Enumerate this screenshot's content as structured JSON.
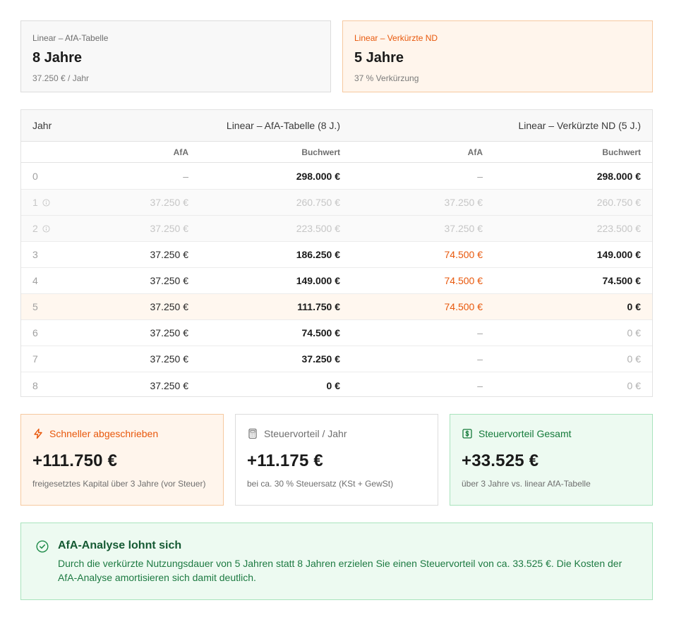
{
  "cards": {
    "linear": {
      "label": "Linear – AfA-Tabelle",
      "value": "8 Jahre",
      "sub": "37.250 € / Jahr"
    },
    "verkuerzt": {
      "label": "Linear – Verkürzte ND",
      "value": "5 Jahre",
      "sub": "37 % Verkürzung"
    }
  },
  "table": {
    "col_year": "Jahr",
    "group1": "Linear – AfA-Tabelle (8 J.)",
    "group2": "Linear – Verkürzte ND (5 J.)",
    "afa": "AfA",
    "buchwert": "Buchwert",
    "rows": [
      {
        "year": "0",
        "afa1": "–",
        "bw1": "298.000 €",
        "afa2": "–",
        "bw2": "298.000 €"
      },
      {
        "year": "1",
        "afa1": "37.250 €",
        "bw1": "260.750 €",
        "afa2": "37.250 €",
        "bw2": "260.750 €"
      },
      {
        "year": "2",
        "afa1": "37.250 €",
        "bw1": "223.500 €",
        "afa2": "37.250 €",
        "bw2": "223.500 €"
      },
      {
        "year": "3",
        "afa1": "37.250 €",
        "bw1": "186.250 €",
        "afa2": "74.500 €",
        "bw2": "149.000 €"
      },
      {
        "year": "4",
        "afa1": "37.250 €",
        "bw1": "149.000 €",
        "afa2": "74.500 €",
        "bw2": "74.500 €"
      },
      {
        "year": "5",
        "afa1": "37.250 €",
        "bw1": "111.750 €",
        "afa2": "74.500 €",
        "bw2": "0 €"
      },
      {
        "year": "6",
        "afa1": "37.250 €",
        "bw1": "74.500 €",
        "afa2": "–",
        "bw2": "0 €"
      },
      {
        "year": "7",
        "afa1": "37.250 €",
        "bw1": "37.250 €",
        "afa2": "–",
        "bw2": "0 €"
      },
      {
        "year": "8",
        "afa1": "37.250 €",
        "bw1": "0 €",
        "afa2": "–",
        "bw2": "0 €"
      }
    ]
  },
  "stats": {
    "schneller": {
      "icon": "lightning-icon",
      "title": "Schneller abgeschrieben",
      "value": "+111.750 €",
      "desc": "freigesetztes Kapital über 3 Jahre (vor Steuer)"
    },
    "jahr": {
      "icon": "calculator-icon",
      "title": "Steuervorteil / Jahr",
      "value": "+11.175 €",
      "desc": "bei ca. 30 % Steuersatz (KSt + GewSt)"
    },
    "gesamt": {
      "icon": "banknote-icon",
      "title": "Steuervorteil Gesamt",
      "value": "+33.525 €",
      "desc": "über 3 Jahre vs. linear AfA-Tabelle"
    }
  },
  "notice": {
    "icon": "check-circle-icon",
    "title": "AfA-Analyse lohnt sich",
    "text": "Durch die verkürzte Nutzungsdauer von 5 Jahren statt 8 Jahren erzielen Sie einen Steuervorteil von ca. 33.525 €. Die Kosten der AfA-Analyse amortisieren sich damit deutlich."
  },
  "colors": {
    "accent_orange": "#e8580c",
    "accent_green": "#147a3a"
  }
}
